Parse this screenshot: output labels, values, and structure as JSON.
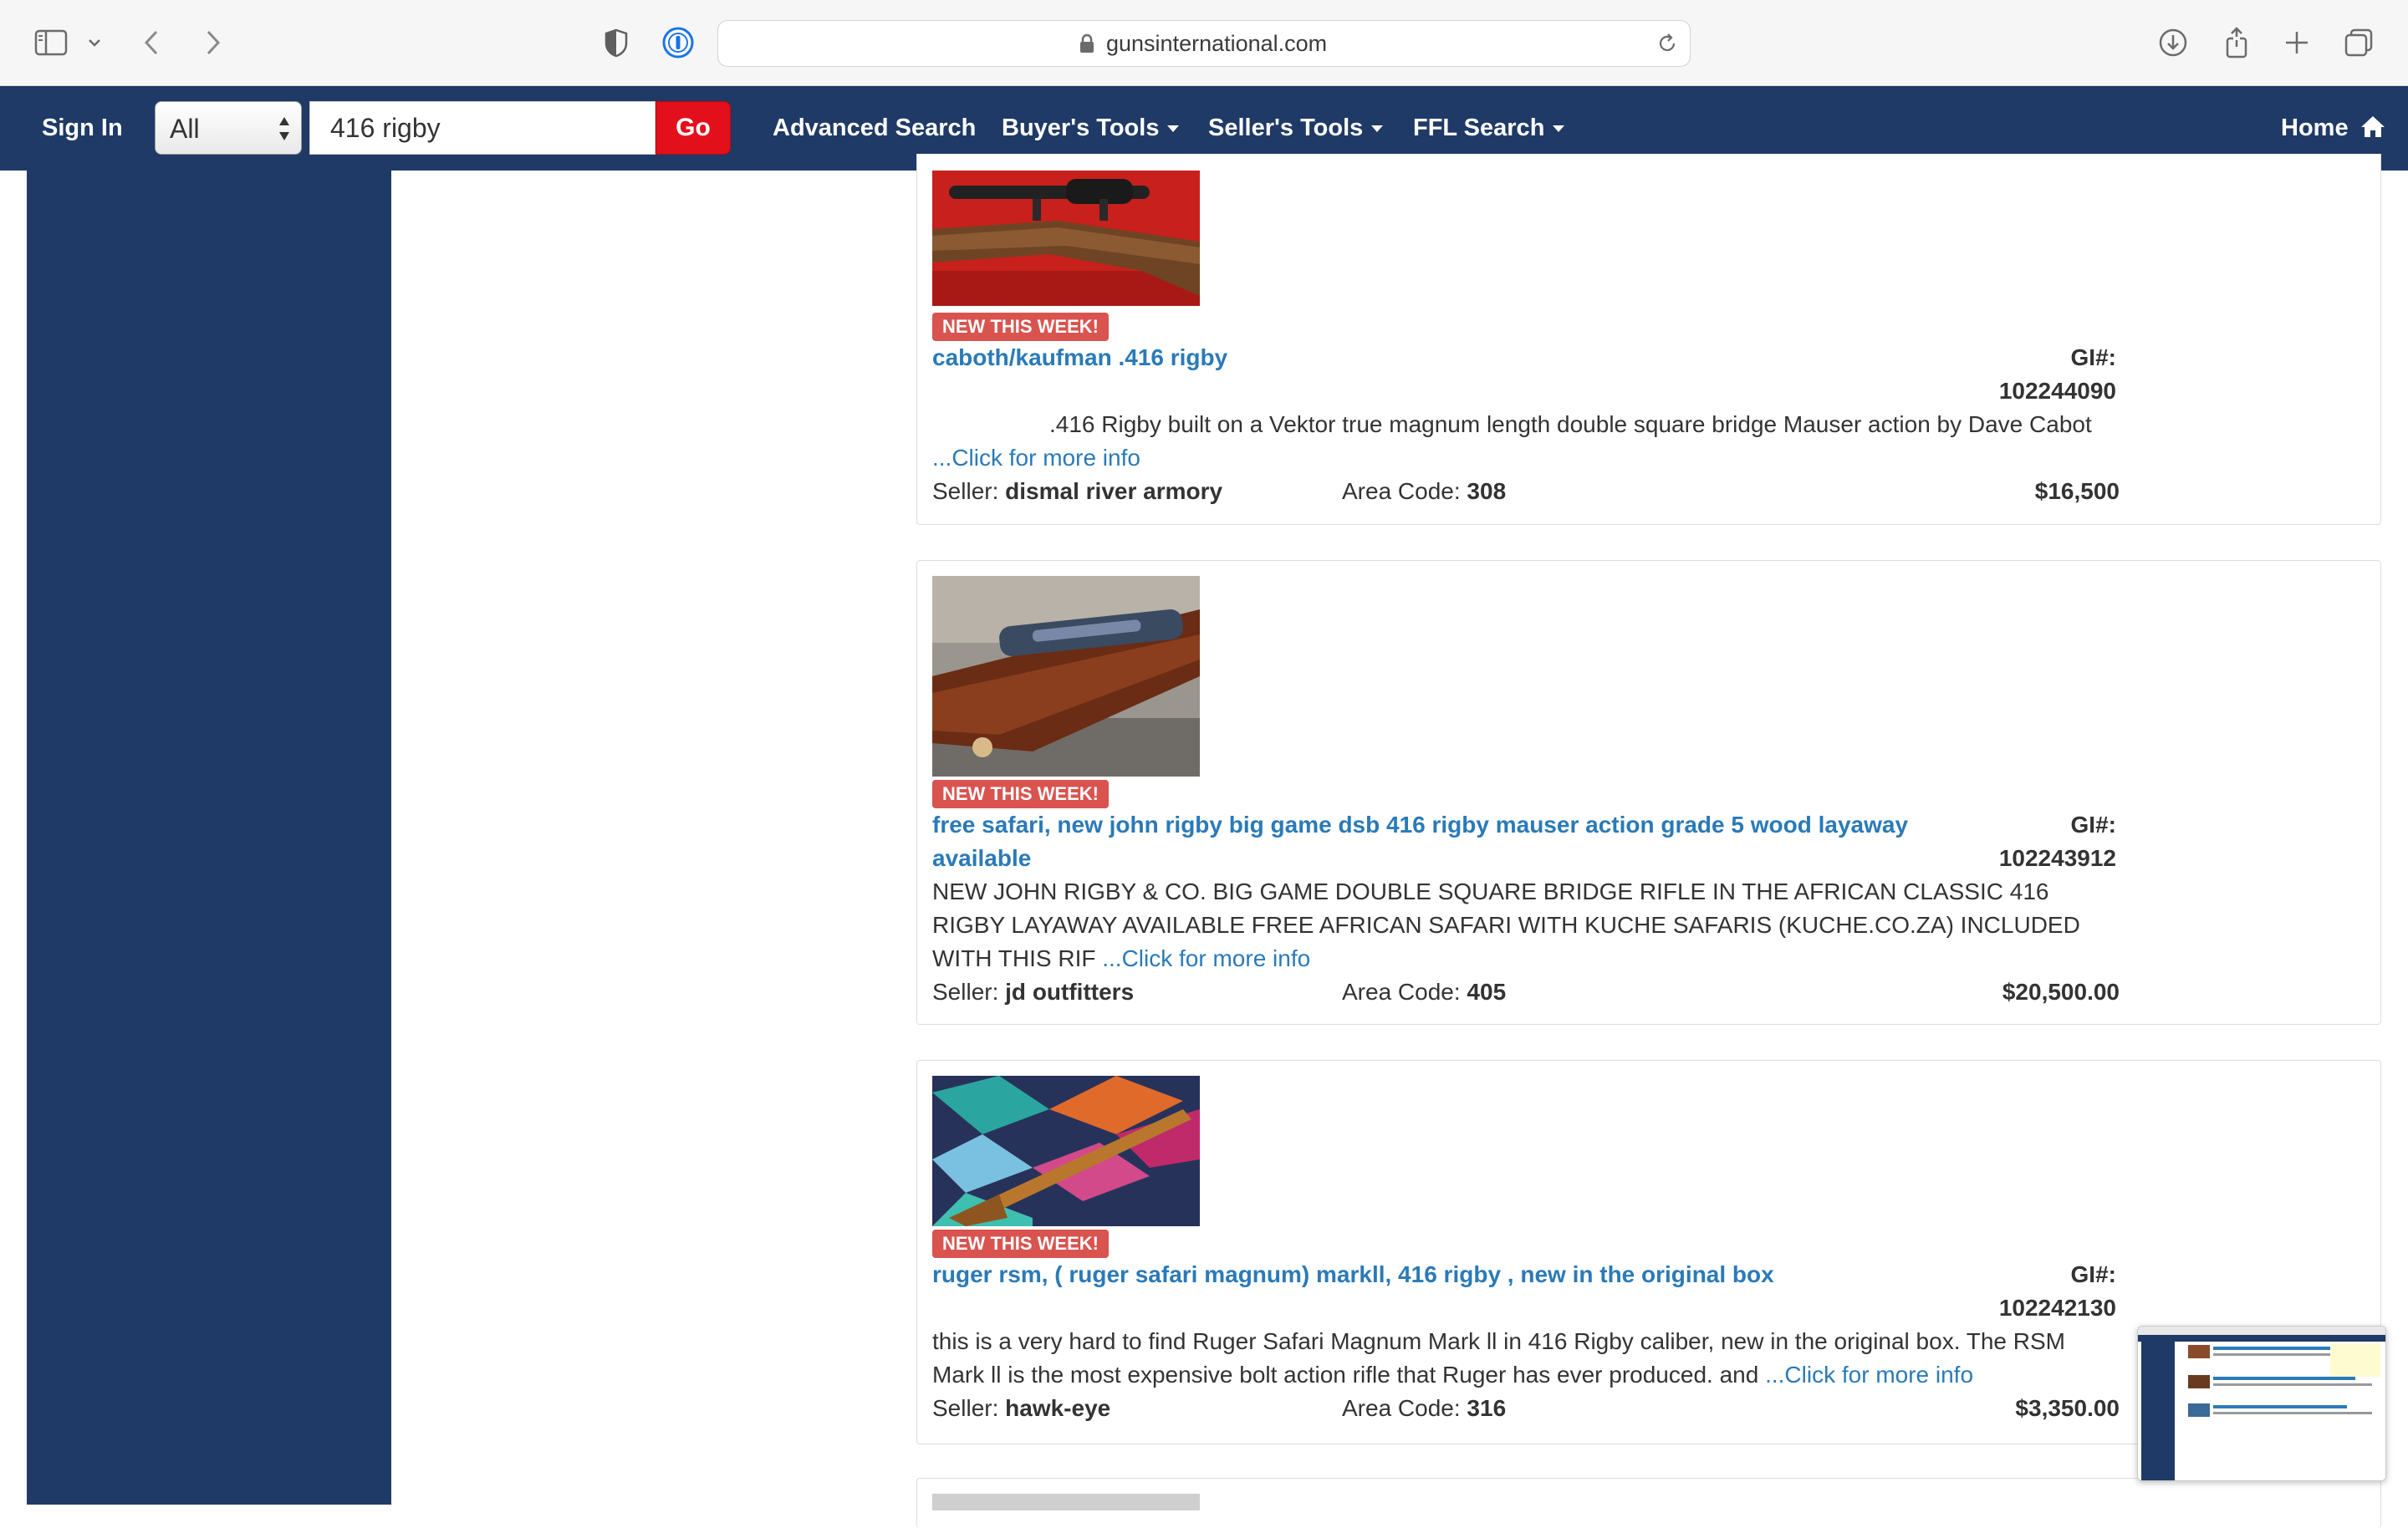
{
  "browser": {
    "url": "gunsinternational.com",
    "icons": [
      "sidebar-icon",
      "chevron-down-icon",
      "back-icon",
      "forward-icon",
      "shield-icon",
      "password-manager-icon",
      "lock-icon",
      "reload-icon",
      "download-icon",
      "share-icon",
      "new-tab-icon",
      "tabs-overview-icon"
    ]
  },
  "nav": {
    "sign_in": "Sign In",
    "category_value": "All",
    "search_value": "416 rigby",
    "go": "Go",
    "advanced_search": "Advanced Search",
    "buyers_tools": "Buyer's Tools",
    "sellers_tools": "Seller's Tools",
    "ffl_search": "FFL Search",
    "home": "Home",
    "colors": {
      "nav_bg": "#1f3a66",
      "go_bg": "#e30f1b",
      "link": "#2a7ab8",
      "badge": "#d9534f"
    }
  },
  "labels": {
    "gi": "GI#:",
    "seller": "Seller:",
    "area": "Area Code:",
    "more": "...Click for more info"
  },
  "listings": [
    {
      "badge": "NEW THIS WEEK!",
      "title": "caboth/kaufman .416 rigby",
      "gi": "102244090",
      "desc": ".416 Rigby built on a Vektor true magnum length double square bridge Mauser action by Dave Cabot",
      "seller": "dismal river armory",
      "area": "308",
      "price": "$16,500"
    },
    {
      "badge": "NEW THIS WEEK!",
      "title": "free safari, new john rigby big game dsb 416 rigby mauser action grade 5 wood layaway available",
      "gi": "102243912",
      "desc": "NEW JOHN RIGBY & CO. BIG GAME DOUBLE SQUARE BRIDGE RIFLE IN THE AFRICAN CLASSIC 416 RIGBY LAYAWAY AVAILABLE FREE AFRICAN SAFARI WITH KUCHE SAFARIS (KUCHE.CO.ZA) INCLUDED WITH THIS RIF",
      "seller": "jd outfitters",
      "area": "405",
      "price": "$20,500.00"
    },
    {
      "badge": "NEW THIS WEEK!",
      "title": "ruger rsm, ( ruger safari magnum) markll, 416 rigby , new in the original box",
      "gi": "102242130",
      "desc": "this is a very hard to find Ruger Safari Magnum Mark ll in 416 Rigby caliber, new in the original box.  The RSM Mark ll is the most expensive bolt action rifle that Ruger has ever produced. and",
      "seller": "hawk-eye",
      "area": "316",
      "price": "$3,350.00"
    }
  ]
}
